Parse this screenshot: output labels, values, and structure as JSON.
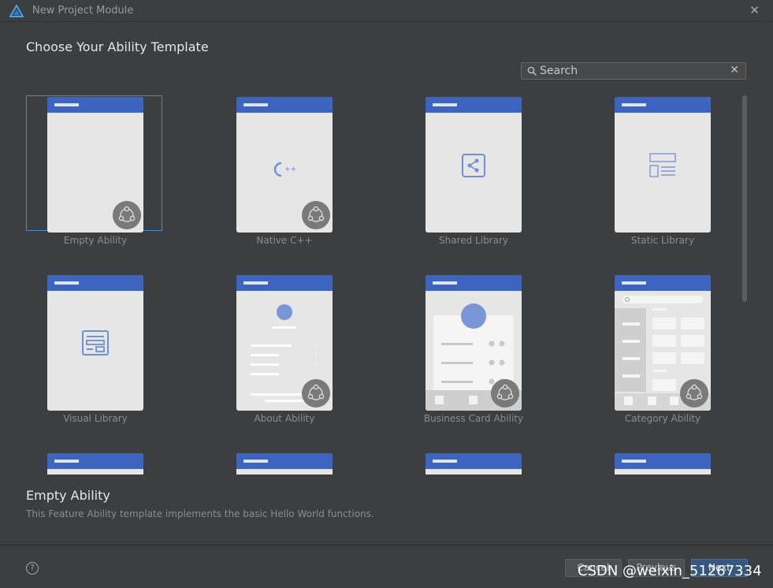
{
  "window": {
    "title": "New Project Module"
  },
  "heading": "Choose Your Ability Template",
  "search": {
    "value": "",
    "placeholder": "Search"
  },
  "templates": [
    {
      "label": "Empty Ability",
      "selected": true
    },
    {
      "label": "Native C++"
    },
    {
      "label": "Shared Library"
    },
    {
      "label": "Static Library"
    },
    {
      "label": "Visual Library"
    },
    {
      "label": "About Ability"
    },
    {
      "label": "Business Card Ability"
    },
    {
      "label": "Category Ability"
    }
  ],
  "description": {
    "title": "Empty Ability",
    "text": "This Feature Ability template implements the basic Hello World functions."
  },
  "footer": {
    "cancel": "Cancel",
    "previous": "Previous",
    "next": "Next"
  },
  "watermark": "CSDN @weixin_51267334",
  "colors": {
    "accent": "#3d64bf",
    "selection": "#4a88c7",
    "background": "#3c3f41"
  }
}
